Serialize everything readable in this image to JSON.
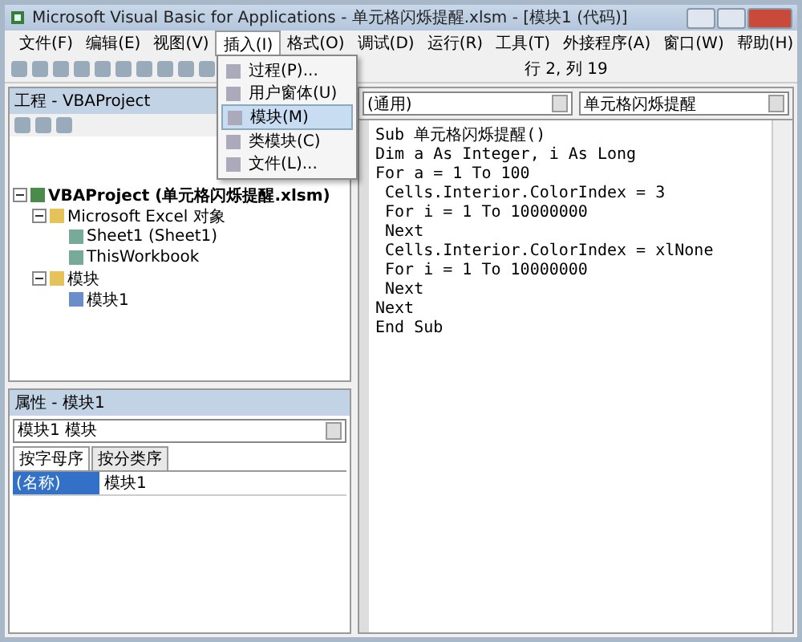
{
  "window": {
    "title": "Microsoft Visual Basic for Applications - 单元格闪烁提醒.xlsm - [模块1 (代码)]"
  },
  "menu_bar": [
    {
      "label": "文件(F)",
      "selected": false
    },
    {
      "label": "编辑(E)",
      "selected": false
    },
    {
      "label": "视图(V)",
      "selected": false
    },
    {
      "label": "插入(I)",
      "selected": true
    },
    {
      "label": "格式(O)",
      "selected": false
    },
    {
      "label": "调试(D)",
      "selected": false
    },
    {
      "label": "运行(R)",
      "selected": false
    },
    {
      "label": "工具(T)",
      "selected": false
    },
    {
      "label": "外接程序(A)",
      "selected": false
    },
    {
      "label": "窗口(W)",
      "selected": false
    },
    {
      "label": "帮助(H)",
      "selected": false
    }
  ],
  "insert_menu": [
    {
      "label": "过程(P)...",
      "selected": false
    },
    {
      "label": "用户窗体(U)",
      "selected": false
    },
    {
      "label": "模块(M)",
      "selected": true
    },
    {
      "label": "类模块(C)",
      "selected": false
    },
    {
      "label": "文件(L)...",
      "selected": false
    }
  ],
  "toolbar": {
    "position": "行 2, 列 19"
  },
  "project_pane": {
    "title": "工程 - VBAProject",
    "tree": [
      {
        "label": "VBAProject (单元格闪烁提醒.xlsm)",
        "kind": "project",
        "expanded": true,
        "children": [
          {
            "label": "Microsoft Excel 对象",
            "kind": "folder",
            "expanded": true,
            "children": [
              {
                "label": "Sheet1 (Sheet1)",
                "kind": "sheet"
              },
              {
                "label": "ThisWorkbook",
                "kind": "workbook"
              }
            ]
          },
          {
            "label": "模块",
            "kind": "folder",
            "expanded": true,
            "children": [
              {
                "label": "模块1",
                "kind": "module"
              }
            ]
          }
        ]
      }
    ]
  },
  "properties_pane": {
    "title": "属性 - 模块1",
    "object": "模块1 模块",
    "tabs": [
      {
        "label": "按字母序",
        "selected": true
      },
      {
        "label": "按分类序",
        "selected": false
      }
    ],
    "rows": [
      {
        "name": "(名称)",
        "value": "模块1"
      }
    ]
  },
  "code_window": {
    "object": "(通用)",
    "procedure": "单元格闪烁提醒",
    "lines": [
      "Sub 单元格闪烁提醒()",
      "Dim a As Integer, i As Long",
      "For a = 1 To 100",
      " Cells.Interior.ColorIndex = 3",
      " For i = 1 To 10000000",
      " Next",
      " Cells.Interior.ColorIndex = xlNone",
      " For i = 1 To 10000000",
      " Next",
      "Next",
      "End Sub"
    ]
  }
}
